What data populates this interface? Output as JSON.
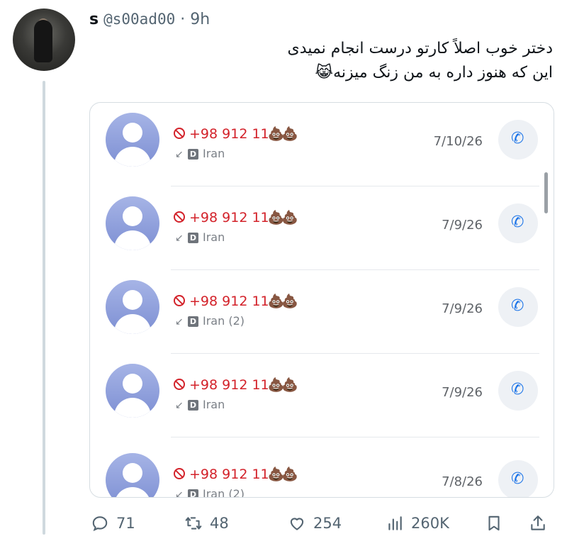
{
  "tweet": {
    "display_name": "s",
    "handle": "@s00ad00",
    "separator": "·",
    "time": "9h",
    "text_line1": "دختر خوب اصلاً کارتو درست انجام نمیدی",
    "text_line2": "این که هنوز داره به من زنگ میزنه😹"
  },
  "calls": [
    {
      "number": "+98 912 11",
      "emoji": "💩💩",
      "country": "Iran",
      "date": "7/10/26"
    },
    {
      "number": "+98 912 11",
      "emoji": "💩💩",
      "country": "Iran",
      "date": "7/9/26"
    },
    {
      "number": "+98 912 11",
      "emoji": "💩💩",
      "country": "Iran (2)",
      "date": "7/9/26"
    },
    {
      "number": "+98 912 11",
      "emoji": "💩💩",
      "country": "Iran",
      "date": "7/9/26"
    },
    {
      "number": "+98 912 11",
      "emoji": "💩💩",
      "country": "Iran (2)",
      "date": "7/8/26"
    }
  ],
  "sim_badge": "D",
  "actions": {
    "replies": "71",
    "reposts": "48",
    "likes": "254",
    "views": "260K"
  },
  "colors": {
    "blocked_red": "#d3222a",
    "call_blue": "#1a73e8",
    "muted_text": "#536471"
  },
  "icons": [
    "reply-icon",
    "repost-icon",
    "like-icon",
    "views-icon",
    "bookmark-icon",
    "share-icon",
    "block-icon",
    "incoming-arrow-icon",
    "phone-icon"
  ]
}
